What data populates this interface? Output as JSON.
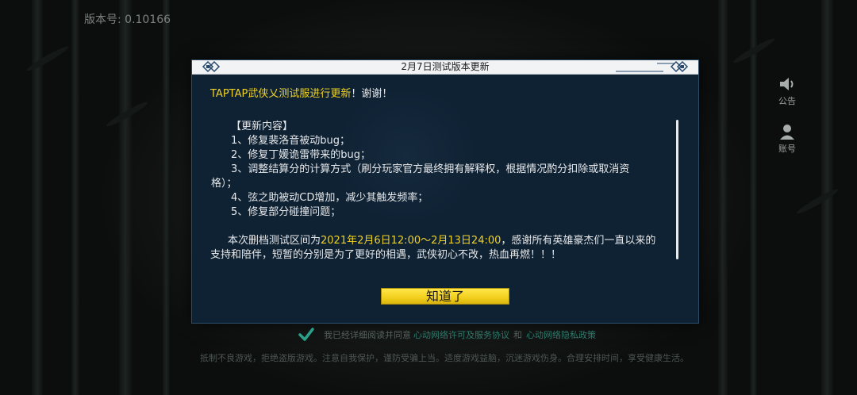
{
  "version": {
    "label": "版本号: 0.10166"
  },
  "side": {
    "announcement_label": "公告",
    "account_label": "账号"
  },
  "dialog": {
    "title": "2月7日测试版本更新",
    "headline_part1": "TAPTAP武侠乂测试服进行更新",
    "headline_part2": "！谢谢！",
    "section_title": "【更新内容】",
    "items": [
      "1、修复裴洛音被动bug；",
      "2、修复丁媛诡雷带来的bug；",
      "3、调整结算分的计算方式（刷分玩家官方最终拥有解释权，根据情况酌分扣除或取消资",
      "格）；",
      "4、弦之助被动CD增加，减少其触发频率；",
      "5、修复部分碰撞问题；"
    ],
    "notice_part1": "本次删档测试区间为",
    "notice_date": "2021年2月6日12:00～2月13日24:00",
    "notice_part2": "，感谢所有英雄豪杰们一直以来的",
    "notice_line2": "支持和陪伴，短暂的分别是为了更好的相遇，武侠初心不改，热血再燃！！！",
    "ok_label": "知道了"
  },
  "agreement": {
    "prefix": "我已经详细阅读并同意",
    "license_link": "心动网络许可及服务协议",
    "and": "和",
    "privacy_link": "心动网络隐私政策"
  },
  "footer": {
    "health_notice": "抵制不良游戏，拒绝盗版游戏。注意自我保护，谨防受骗上当。适度游戏益脑，沉迷游戏伤身。合理安排时间，享受健康生活。"
  },
  "colors": {
    "accent_yellow": "#f0d225",
    "dialog_bg": "#0f2234",
    "link_teal": "#2f7a6c"
  }
}
